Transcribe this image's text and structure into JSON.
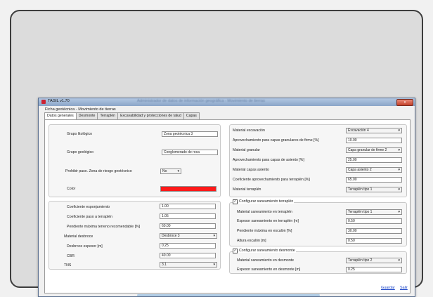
{
  "window": {
    "title": "TAGIL v1.70",
    "blurred_caption": "Administrador de datos de información geográfica - Movimiento de tierras",
    "close_label": "x",
    "subtitle": "Ficha geotécnica - Movimiento de tierras"
  },
  "tabs": [
    {
      "label": "Datos generales"
    },
    {
      "label": "Desmonte"
    },
    {
      "label": "Terraplén"
    },
    {
      "label": "Excavabilidad y protecciones de talud"
    },
    {
      "label": "Capas"
    }
  ],
  "left_top": {
    "grupo_litologico_label": "Grupo litológico",
    "grupo_litologico_value": "Zona geotécnica 3",
    "grupo_geologico_label": "Grupo geológico",
    "grupo_geologico_value": "Conglomerado de roca",
    "prohibir_label": "Prohibir paso. Zona de riesgo geotécnico",
    "prohibir_value": "No",
    "color_label": "Color",
    "color_value": "#ff1a1a"
  },
  "left_bottom": {
    "esponjamiento_label": "Coeficiente esponjamiento",
    "esponjamiento_value": "1.00",
    "paso_terraplen_label": "Coeficiente paso a terraplén",
    "paso_terraplen_value": "1.05",
    "pendiente_label": "Pendiente máxima terreno recomendable [%]",
    "pendiente_value": "60.00",
    "material_desbroce_label": "Material desbroce",
    "material_desbroce_value": "Desbroce 3",
    "desbroce_espesor_label": "Desbroce espesor [m]",
    "desbroce_espesor_value": "0.25",
    "cbr_label": "CBR",
    "cbr_value": "40.00",
    "tns_label": "TNS",
    "tns_value": "3.1"
  },
  "right_top": {
    "material_excavacion_label": "Material excavación",
    "material_excavacion_value": "Excavación 4",
    "aprov_granulares_label": "Aprovechamiento para capas granulares de firme [%]",
    "aprov_granulares_value": "10.00",
    "material_granular_label": "Material granular",
    "material_granular_value": "Capa granular de firme 2",
    "aprov_asiento_label": "Aprovechamiento para capas de asiento [%]",
    "aprov_asiento_value": "25.00",
    "material_capas_asiento_label": "Material capas asiento",
    "material_capas_asiento_value": "Capa asiento 2",
    "coef_aprov_terraplen_label": "Coeficiente aprovechamiento para terraplén [%]",
    "coef_aprov_terraplen_value": "65.00",
    "material_terraplen_label": "Material terraplén",
    "material_terraplen_value": "Terraplén tipo 1"
  },
  "saneamiento_terraplen": {
    "legend": "Configurar saneamiento terraplén",
    "material_label": "Material saneamiento en terraplén",
    "material_value": "Terraplén tipo 1",
    "espesor_label": "Espesor saneamiento en terraplén [m]",
    "espesor_value": "0.50",
    "pendiente_label": "Pendiente máxima en escalón [%]",
    "pendiente_value": "30.00",
    "altura_label": "Altura escalón [m]",
    "altura_value": "0.50"
  },
  "saneamiento_desmonte": {
    "legend": "Configurar saneamiento desmonte",
    "material_label": "Material saneamiento en desmonte",
    "material_value": "Terraplén tipo 2",
    "espesor_label": "Espesor saneamiento en desmonte [m]",
    "espesor_value": "0.25"
  },
  "footer": {
    "guardar": "Guardar",
    "salir": "Salir"
  },
  "icons": {
    "dropdown": "chevron-down-icon",
    "checkbox": "check-icon",
    "app": "app-icon"
  },
  "colors": {
    "title_gradient_top": "#b3c8e2",
    "link": "#1a44c8"
  }
}
